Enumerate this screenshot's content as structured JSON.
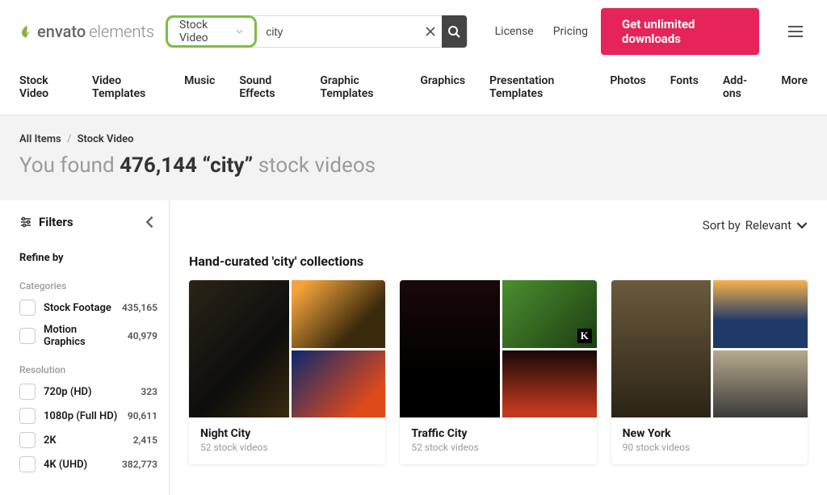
{
  "brand": {
    "name1": "envato",
    "name2": "elements"
  },
  "search": {
    "filter_label": "Stock Video",
    "query": "city",
    "placeholder": ""
  },
  "header": {
    "license": "License",
    "pricing": "Pricing",
    "cta": "Get unlimited downloads"
  },
  "nav": [
    "Stock Video",
    "Video Templates",
    "Music",
    "Sound Effects",
    "Graphic Templates",
    "Graphics",
    "Presentation Templates",
    "Photos",
    "Fonts",
    "Add-ons",
    "More"
  ],
  "breadcrumb": {
    "root": "All Items",
    "current": "Stock Video"
  },
  "results": {
    "prefix": "You found ",
    "count": "476,144",
    "query": "“city”",
    "suffix": " stock videos"
  },
  "filters": {
    "title": "Filters",
    "refine": "Refine by",
    "groups": [
      {
        "label": "Categories",
        "items": [
          {
            "name": "Stock Footage",
            "count": "435,165"
          },
          {
            "name": "Motion Graphics",
            "count": "40,979"
          }
        ]
      },
      {
        "label": "Resolution",
        "items": [
          {
            "name": "720p (HD)",
            "count": "323"
          },
          {
            "name": "1080p (Full HD)",
            "count": "90,611"
          },
          {
            "name": "2K",
            "count": "2,415"
          },
          {
            "name": "4K (UHD)",
            "count": "382,773"
          }
        ]
      }
    ]
  },
  "sort": {
    "prefix": "Sort by ",
    "value": "Relevant"
  },
  "collections": {
    "title": "Hand-curated 'city' collections",
    "items": [
      {
        "title": "Night City",
        "sub": "52 stock videos"
      },
      {
        "title": "Traffic City",
        "sub": "52 stock videos"
      },
      {
        "title": "New York",
        "sub": "90 stock videos"
      }
    ]
  }
}
